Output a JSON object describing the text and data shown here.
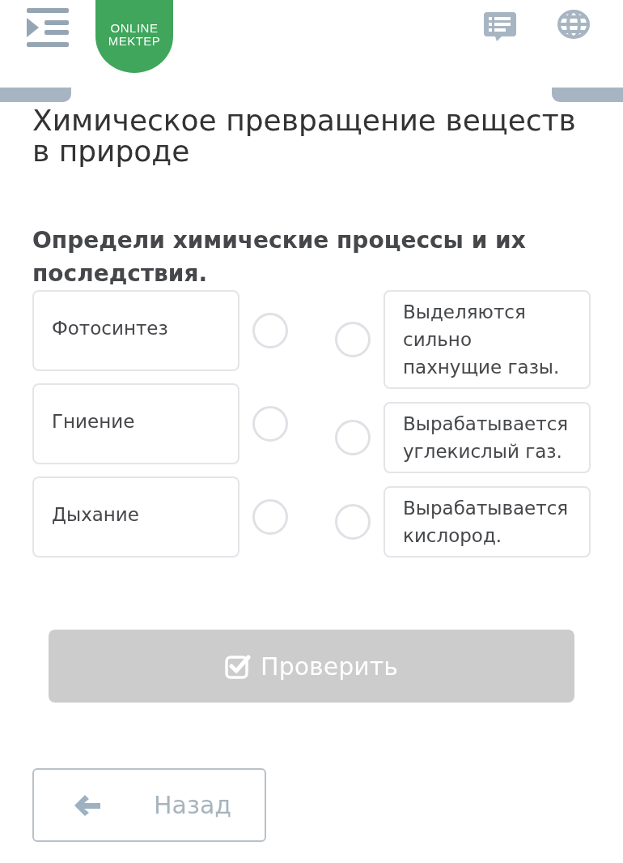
{
  "header": {
    "logo": {
      "lines": [
        "ONLINE",
        "MEKTEP"
      ]
    }
  },
  "title": "Химическое превращение веществ в природе",
  "question": "Определи химические процессы и их последствия.",
  "matching": {
    "left": [
      {
        "label": "Фотосинтез",
        "selected": false
      },
      {
        "label": "Гниение",
        "selected": false
      },
      {
        "label": "Дыхание",
        "selected": false
      }
    ],
    "right": [
      {
        "label": "Выделяются сильно пахнущие газы.",
        "selected": false
      },
      {
        "label": "Вырабатывается углекислый газ.",
        "selected": false
      },
      {
        "label": "Вырабатывается кислород.",
        "selected": false
      }
    ]
  },
  "check_button": {
    "label": "Проверить",
    "disabled": true
  },
  "back_button": {
    "label": "Назад"
  }
}
